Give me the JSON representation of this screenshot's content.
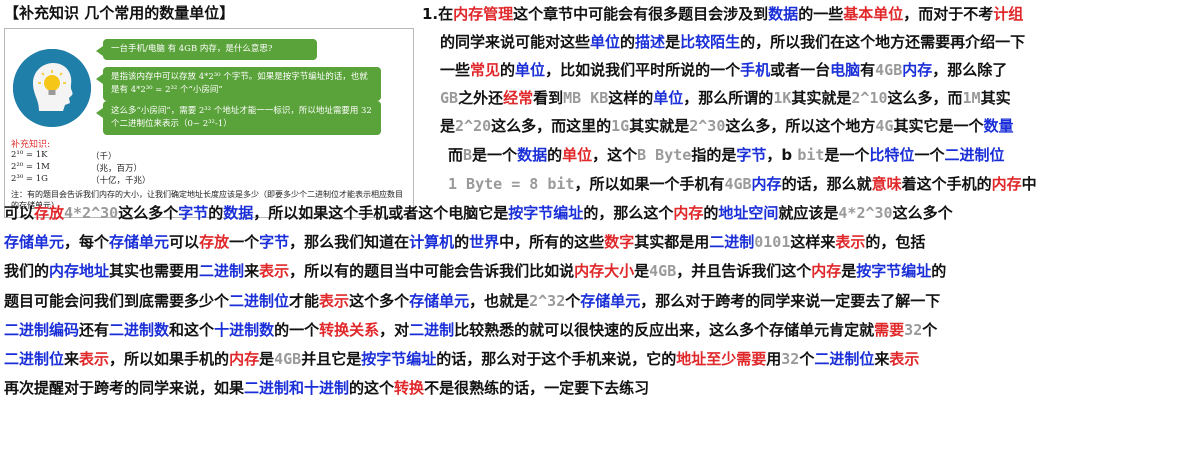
{
  "title": "【补充知识 几个常用的数量单位】",
  "figure": {
    "avatar_icon": "lightbulb-head-icon",
    "bubble1": "一台手机/电脑 有 4GB 内存，是什么意思?",
    "bubble2": "是指该内存中可以存放 4*2³⁰ 个字节。如果是按字节编址的话，也就是有 4*2³⁰ = 2³² 个“小房间”",
    "bubble3": "这么多“小房间”，需要 2³² 个地址才能一一标识，所以地址需要用 32 个二进制位来表示（0~ 2³²-1）",
    "supplement_label": "补充知识:",
    "conversions": [
      {
        "eq": "2¹⁰ = 1K",
        "meaning": "（千）"
      },
      {
        "eq": "2²⁰ = 1M",
        "meaning": "（兆，百万）"
      },
      {
        "eq": "2³⁰ = 1G",
        "meaning": "（十亿，千兆）"
      }
    ],
    "note": "注：有的题目会告诉我们内存的大小，让我们确定地址长度应该是多少（即要多少个二进制位才能表示相应数目的存储单元）"
  },
  "paragraph": {
    "lines": [
      [
        [
          "1.在",
          ""
        ],
        [
          "内存管理",
          "r"
        ],
        [
          "这个章节中可能会有很多题目会涉及到",
          ""
        ],
        [
          "数据",
          "b"
        ],
        [
          "的一些",
          ""
        ],
        [
          "基本单位",
          "r"
        ],
        [
          "，而对于不考",
          ""
        ],
        [
          "计组",
          "r"
        ]
      ],
      [
        [
          "的同学来说可能对这些",
          ""
        ],
        [
          "单位",
          "b"
        ],
        [
          "的",
          ""
        ],
        [
          "描述",
          "b"
        ],
        [
          "是",
          ""
        ],
        [
          "比较陌生",
          "b"
        ],
        [
          "的，所以我们在这个地方还需要再介绍一下",
          ""
        ]
      ],
      [
        [
          "一些",
          ""
        ],
        [
          "常见",
          "r"
        ],
        [
          "的",
          ""
        ],
        [
          "单位",
          "b"
        ],
        [
          "，比如说我们平时所说的一个",
          ""
        ],
        [
          "手机",
          "b"
        ],
        [
          "或者一台",
          ""
        ],
        [
          "电脑",
          "b"
        ],
        [
          "有",
          ""
        ],
        [
          "4GB",
          "g"
        ],
        [
          "内存",
          "b"
        ],
        [
          "，那么除了",
          ""
        ]
      ],
      [
        [
          " GB",
          "g"
        ],
        [
          "之外还",
          ""
        ],
        [
          "经常",
          "r"
        ],
        [
          "看到",
          ""
        ],
        [
          "MB KB",
          "g"
        ],
        [
          "这样的",
          ""
        ],
        [
          "单位",
          "b"
        ],
        [
          "，那么所谓的",
          ""
        ],
        [
          "1K",
          "g"
        ],
        [
          "其实就是",
          ""
        ],
        [
          "2^10",
          "g"
        ],
        [
          "这么多，而",
          ""
        ],
        [
          "1M",
          "g"
        ],
        [
          "其实",
          ""
        ]
      ],
      [
        [
          "是",
          ""
        ],
        [
          "2^20",
          "g"
        ],
        [
          "这么多，而这里的",
          ""
        ],
        [
          "1G",
          "g"
        ],
        [
          "其实就是",
          ""
        ],
        [
          "2^30",
          "g"
        ],
        [
          "这么多，所以这个地方",
          ""
        ],
        [
          "4G",
          "g"
        ],
        [
          "其实它是一个",
          ""
        ],
        [
          "数量",
          "b"
        ]
      ],
      [
        [
          "而",
          ""
        ],
        [
          "B",
          "g"
        ],
        [
          "是一个",
          ""
        ],
        [
          "数据",
          "b"
        ],
        [
          "的",
          ""
        ],
        [
          "单位",
          "r"
        ],
        [
          "，这个",
          ""
        ],
        [
          "B Byte",
          "g"
        ],
        [
          "指的是",
          ""
        ],
        [
          "字节",
          "b"
        ],
        [
          "，b ",
          ""
        ],
        [
          "bit",
          "g"
        ],
        [
          "是一个",
          ""
        ],
        [
          "比特位",
          "b"
        ],
        [
          "一个",
          ""
        ],
        [
          "二进制位",
          "b"
        ]
      ],
      [
        [
          "1 Byte = 8 bit",
          "g"
        ],
        [
          "，所以如果一个手机有",
          ""
        ],
        [
          "4GB",
          "g"
        ],
        [
          "内存",
          "b"
        ],
        [
          "的话，那么就",
          ""
        ],
        [
          "意味",
          "r"
        ],
        [
          "着这个手机的",
          ""
        ],
        [
          "内存",
          "r"
        ],
        [
          "中",
          ""
        ]
      ],
      [
        [
          "可以",
          ""
        ],
        [
          "存放",
          "r"
        ],
        [
          "4*2^30",
          "g"
        ],
        [
          "这么多个",
          ""
        ],
        [
          "字节",
          "b"
        ],
        [
          "的",
          ""
        ],
        [
          "数据",
          "b"
        ],
        [
          "，所以如果这个手机或者这个电脑它是",
          ""
        ],
        [
          "按字节编址",
          "b"
        ],
        [
          "的，那么这个",
          ""
        ],
        [
          "内存",
          "r"
        ],
        [
          "的",
          ""
        ],
        [
          "地址空间",
          "b"
        ],
        [
          "就应该是",
          ""
        ],
        [
          "4*2^30",
          "g"
        ],
        [
          "这么多个",
          ""
        ]
      ],
      [
        [
          "存储单元",
          "b"
        ],
        [
          "，每个",
          ""
        ],
        [
          "存储单元",
          "b"
        ],
        [
          "可以",
          ""
        ],
        [
          "存放",
          "r"
        ],
        [
          "一个",
          ""
        ],
        [
          "字节",
          "b"
        ],
        [
          "，那么我们知道在",
          ""
        ],
        [
          "计算机",
          "b"
        ],
        [
          "的",
          ""
        ],
        [
          "世界",
          "b"
        ],
        [
          "中，所有的这些",
          ""
        ],
        [
          "数字",
          "r"
        ],
        [
          "其实都是用",
          ""
        ],
        [
          "二进制",
          "b"
        ],
        [
          "0101",
          "g"
        ],
        [
          "这样来",
          ""
        ],
        [
          "表示",
          "r"
        ],
        [
          "的，包括",
          ""
        ]
      ],
      [
        [
          "我们的",
          ""
        ],
        [
          "内存地址",
          "b"
        ],
        [
          "其实也需要用",
          ""
        ],
        [
          "二进制",
          "b"
        ],
        [
          "来",
          ""
        ],
        [
          "表示",
          "r"
        ],
        [
          "，所以有的题目当中可能会告诉我们比如说",
          ""
        ],
        [
          "内存大小",
          "r"
        ],
        [
          "是",
          ""
        ],
        [
          "4GB",
          "g"
        ],
        [
          "，并且告诉我们这个",
          ""
        ],
        [
          "内存",
          "r"
        ],
        [
          "是",
          ""
        ],
        [
          "按字节编址",
          "b"
        ],
        [
          "的",
          ""
        ]
      ],
      [
        [
          "题目可能会问我们到底需要多少个",
          ""
        ],
        [
          "二进制位",
          "b"
        ],
        [
          "才能",
          ""
        ],
        [
          "表示",
          "r"
        ],
        [
          "这个多个",
          ""
        ],
        [
          "存储单元",
          "b"
        ],
        [
          "，也就是",
          ""
        ],
        [
          "2^32",
          "g"
        ],
        [
          "个",
          ""
        ],
        [
          "存储单元",
          "b"
        ],
        [
          "，那么对于跨考的同学来说一定要去了解一下",
          ""
        ]
      ],
      [
        [
          "二进制编码",
          "b"
        ],
        [
          "还有",
          ""
        ],
        [
          "二进制数",
          "b"
        ],
        [
          "和这个",
          ""
        ],
        [
          "十进制数",
          "b"
        ],
        [
          "的一个",
          ""
        ],
        [
          "转换关系",
          "r"
        ],
        [
          "，对",
          ""
        ],
        [
          "二进制",
          "b"
        ],
        [
          "比较熟悉的就可以很快速的反应出来，这么多个存储单元肯定就",
          ""
        ],
        [
          "需要",
          "r"
        ],
        [
          "32",
          "g"
        ],
        [
          "个",
          ""
        ]
      ],
      [
        [
          "二进制位",
          "b"
        ],
        [
          "来",
          ""
        ],
        [
          "表示",
          "r"
        ],
        [
          "，所以如果手机的",
          ""
        ],
        [
          "内存",
          "r"
        ],
        [
          "是",
          ""
        ],
        [
          "4GB",
          "g"
        ],
        [
          "并且它是",
          ""
        ],
        [
          "按字节编址",
          "b"
        ],
        [
          "的话，那么对于这个手机来说，它的",
          ""
        ],
        [
          "地址至少需要",
          "r"
        ],
        [
          "用",
          ""
        ],
        [
          "32",
          "g"
        ],
        [
          "个",
          ""
        ],
        [
          "二进制位",
          "b"
        ],
        [
          "来",
          ""
        ],
        [
          "表示",
          "r"
        ]
      ],
      [
        [
          "再次提醒对于跨考的同学来说，如果",
          ""
        ],
        [
          "二进制和十进制",
          "b"
        ],
        [
          "的这个",
          ""
        ],
        [
          "转换",
          "r"
        ],
        [
          "不是很熟练的话，一定要下去练习",
          ""
        ]
      ]
    ]
  }
}
